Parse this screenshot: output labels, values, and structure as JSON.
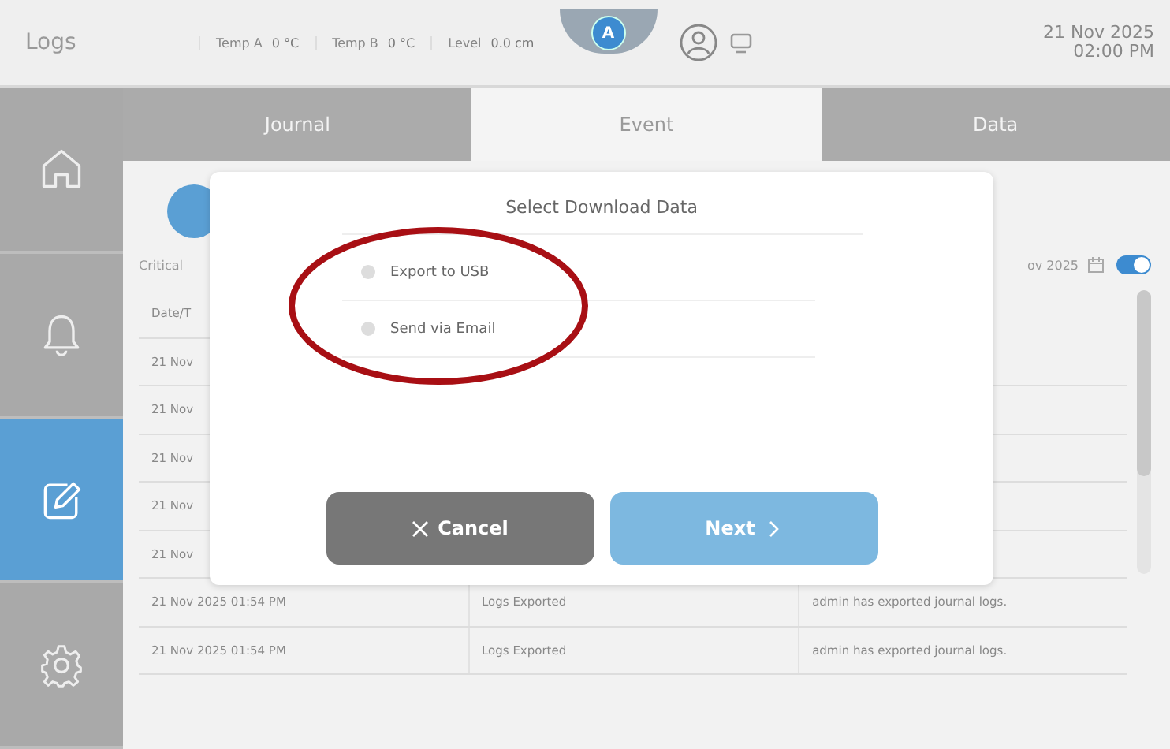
{
  "top_bar": {
    "title": "Logs",
    "readings": [
      {
        "label": "Temp A",
        "value": "0 °C"
      },
      {
        "label": "Temp B",
        "value": "0 °C"
      },
      {
        "label": "Level",
        "value": "0.0 cm"
      }
    ],
    "badge": "A",
    "date": "21 Nov 2025",
    "time": "02:00 PM"
  },
  "sidebar": {
    "items": [
      {
        "kind": "home",
        "selected": false
      },
      {
        "kind": "bell",
        "selected": false
      },
      {
        "kind": "edit",
        "selected": true
      },
      {
        "kind": "gear",
        "selected": false
      }
    ]
  },
  "tabs": [
    {
      "label": "Journal",
      "selected": false
    },
    {
      "label": "Event",
      "selected": true
    },
    {
      "label": "Data",
      "selected": false
    }
  ],
  "filters": {
    "label": "Critical",
    "date": "ov 2025",
    "toggle_on": true
  },
  "table": {
    "header": "Date/T",
    "rows": [
      {
        "cells": [
          "21 Nov"
        ]
      },
      {
        "cells": [
          "21 Nov"
        ]
      },
      {
        "cells": [
          "21 Nov"
        ]
      },
      {
        "cells": [
          "21 Nov"
        ]
      },
      {
        "cells": [
          "21 Nov"
        ]
      },
      {
        "cells": [
          "21 Nov 2025 01:54 PM",
          "Logs Exported",
          "admin has exported journal logs."
        ]
      },
      {
        "cells": [
          "21 Nov 2025 01:54 PM",
          "Logs Exported",
          "admin has exported journal logs."
        ]
      }
    ]
  },
  "dialog": {
    "title": "Select Download Data",
    "options": [
      {
        "label": "Export to USB",
        "selected": false
      },
      {
        "label": "Send via Email",
        "selected": false
      }
    ],
    "buttons": [
      {
        "kind": "cancel",
        "label": "Cancel",
        "disabled": false
      },
      {
        "kind": "next",
        "label": "Next",
        "disabled": true
      }
    ]
  }
}
